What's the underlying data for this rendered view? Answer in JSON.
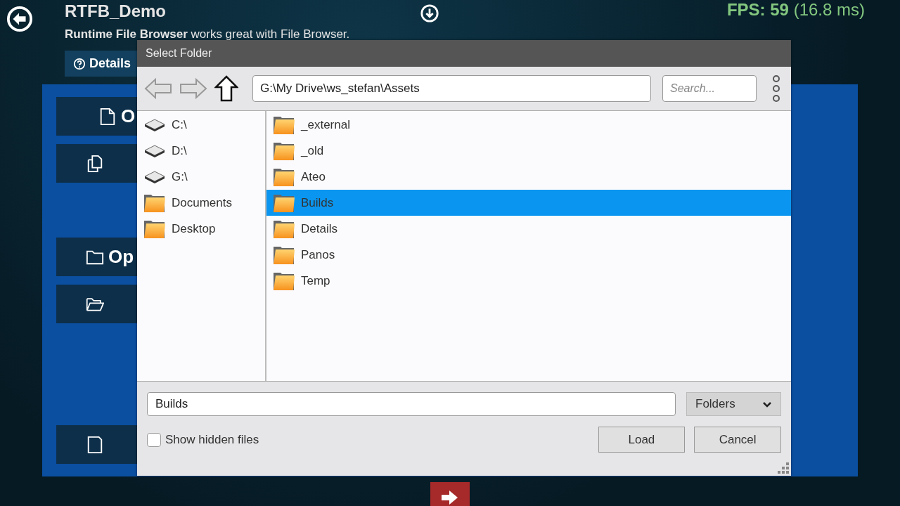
{
  "app": {
    "title": "RTFB_Demo",
    "subtitle": "**Runtime File Browser** works great with File Browser.",
    "details_button": "Details",
    "fps": "**FPS: 59** (16.8 ms)"
  },
  "menu_groups": [
    [
      {
        "kind": "file",
        "label": "O"
      },
      {
        "kind": "files"
      }
    ],
    [
      {
        "kind": "folder",
        "label": "Op"
      },
      {
        "kind": "folder-open"
      }
    ],
    [
      {
        "kind": "save"
      }
    ]
  ],
  "dialog": {
    "title": "Select Folder",
    "nav_buttons": [
      {
        "kind": "back",
        "disabled": true
      },
      {
        "kind": "forward",
        "disabled": true
      },
      {
        "kind": "up",
        "disabled": false
      }
    ],
    "path": "G:\\My Drive\\ws_stefan\\Assets",
    "search": {
      "placeholder": "Search..."
    },
    "quick_links": [
      {
        "kind": "drive",
        "label": "C:\\"
      },
      {
        "kind": "drive",
        "label": "D:\\"
      },
      {
        "kind": "drive",
        "label": "G:\\"
      },
      {
        "kind": "folder",
        "label": "Documents"
      },
      {
        "kind": "folder",
        "label": "Desktop"
      }
    ],
    "items": [
      {
        "label": "_external",
        "selected": false
      },
      {
        "label": "_old",
        "selected": false
      },
      {
        "label": "Ateo",
        "selected": false
      },
      {
        "label": "Builds",
        "selected": true
      },
      {
        "label": "Details",
        "selected": false
      },
      {
        "label": "Panos",
        "selected": false
      },
      {
        "label": "Temp",
        "selected": false
      }
    ],
    "filename": "Builds",
    "filter": "Folders",
    "show_hidden": {
      "label": "Show hidden files",
      "checked": false
    },
    "buttons": [
      "Load",
      "Cancel"
    ]
  }
}
